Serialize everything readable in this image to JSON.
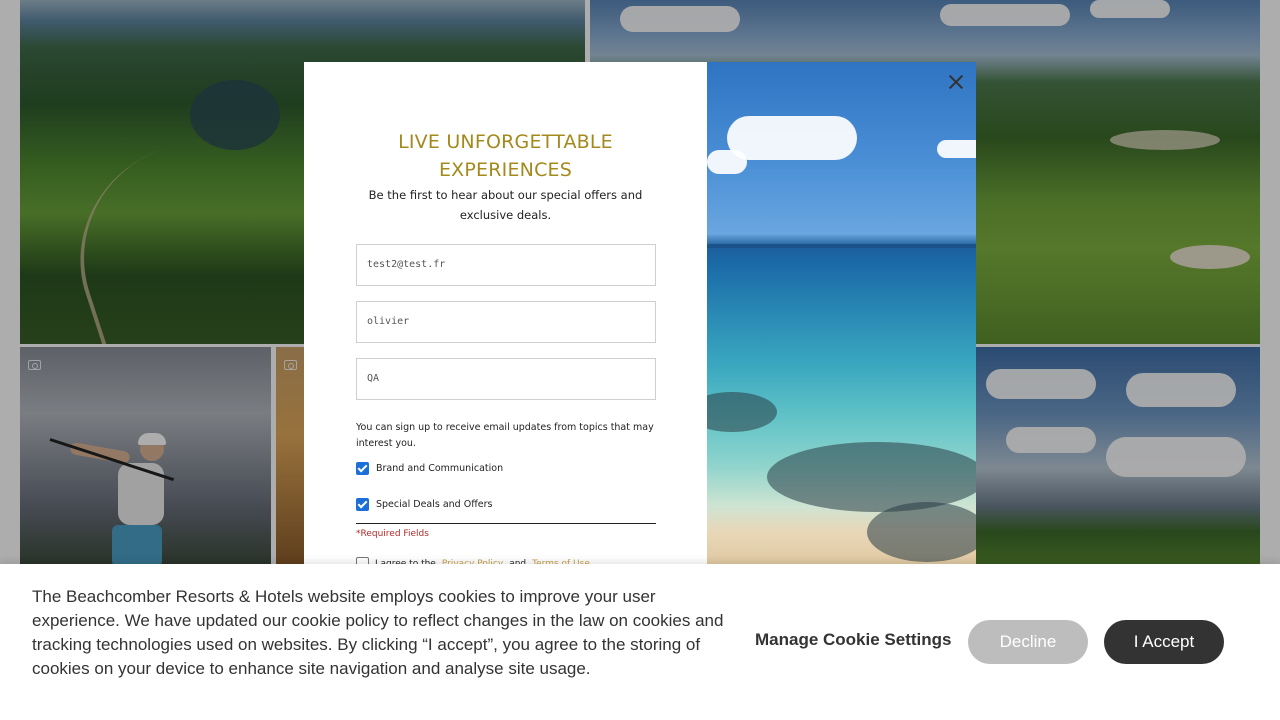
{
  "modal": {
    "title_line1": "LIVE UNFORGETTABLE",
    "title_line2": "EXPERIENCES",
    "subtitle": "Be the first to hear about our special offers and exclusive deals.",
    "fields": [
      {
        "value": "test2@test.fr"
      },
      {
        "value": "olivier"
      },
      {
        "value": "QA"
      }
    ],
    "topics_text": "You can sign up to receive email updates from topics that may interest you.",
    "checkboxes": [
      {
        "label": "Brand and Communication",
        "checked": true
      },
      {
        "label": "Special Deals and Offers",
        "checked": true
      }
    ],
    "required_marker": "*",
    "required_text": "Required Fields",
    "agree": {
      "prefix": "I agree to the",
      "privacy_link": "Privacy Policy",
      "and_text": "and",
      "terms_link": "Terms of Use",
      "checked": false
    }
  },
  "cookie_banner": {
    "text": "The Beachcomber Resorts & Hotels website employs cookies to improve your user experience. We have updated our cookie policy to reflect changes in the law on cookies and tracking technologies used on websites. By clicking “I accept”, you agree to the storing of cookies on your device to enhance site navigation and analyse site usage.",
    "manage_label": "Manage Cookie Settings",
    "decline_label": "Decline",
    "accept_label": "I Accept"
  },
  "colors": {
    "title_gold": "#a48a1c",
    "checkbox_blue": "#1b6fd6",
    "required_red": "#b22a2a",
    "accept_dark": "#333333",
    "decline_gray": "#bdbdbd"
  },
  "icons": [
    "camera-icon",
    "close-icon",
    "checkbox-checked-icon"
  ]
}
